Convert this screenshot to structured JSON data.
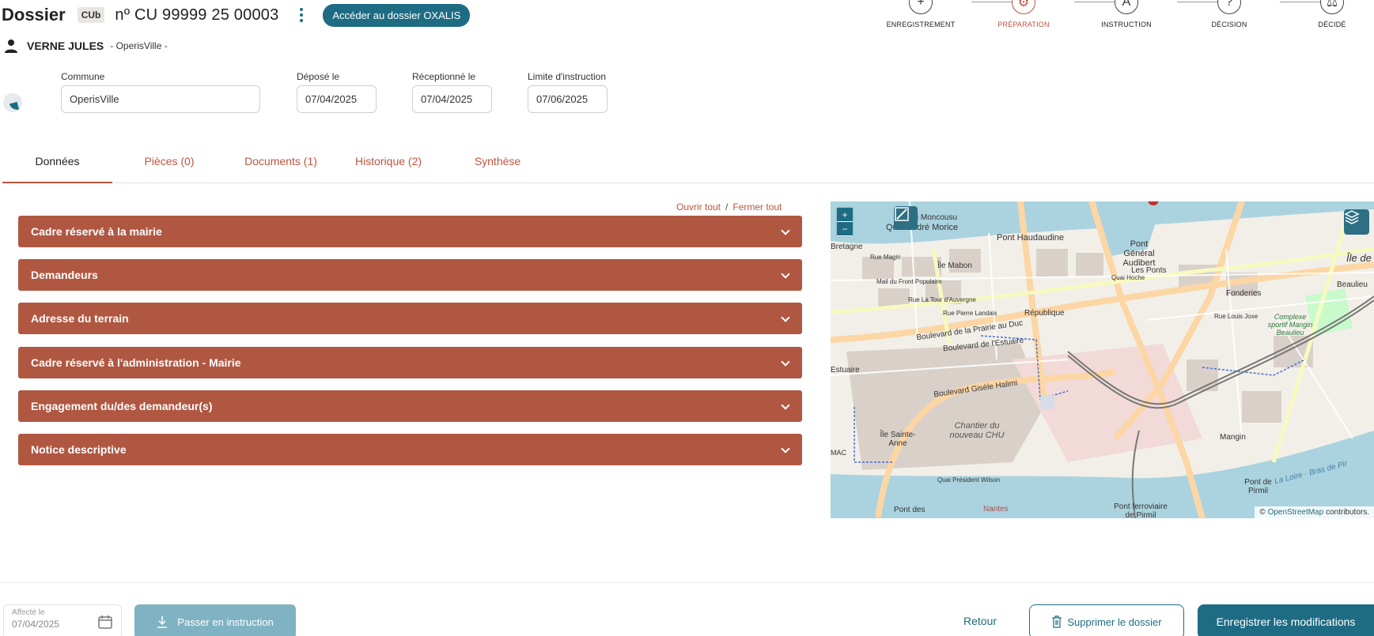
{
  "header": {
    "title": "Dossier",
    "type_badge": "CUb",
    "dossier_number": "nº CU 99999 25 00003",
    "oxalis_button": "Accéder au dossier OXALIS"
  },
  "applicant": {
    "name": "VERNE JULES",
    "city": "- OperisVille -"
  },
  "workflow": {
    "steps": [
      {
        "label": "ENREGISTREMENT",
        "icon": "plus-icon",
        "glyph": "+"
      },
      {
        "label": "PRÉPARATION",
        "icon": "gear-icon",
        "glyph": "⚙"
      },
      {
        "label": "INSTRUCTION",
        "icon": "letter-a-icon",
        "glyph": "A"
      },
      {
        "label": "DÉCISION",
        "icon": "question-icon",
        "glyph": "?"
      },
      {
        "label": "DÉCIDÉ",
        "icon": "gavel-icon",
        "glyph": "⚖"
      }
    ],
    "active_step": "PRÉPARATION"
  },
  "fields": {
    "commune": {
      "label": "Commune",
      "value": "OperisVille"
    },
    "depose": {
      "label": "Déposé le",
      "value": "07/04/2025"
    },
    "receptionne": {
      "label": "Réceptionné le",
      "value": "07/04/2025"
    },
    "limite": {
      "label": "Limite d'instruction",
      "value": "07/06/2025"
    }
  },
  "tabs": [
    {
      "label": "Données"
    },
    {
      "label": "Pièces (0)"
    },
    {
      "label": "Documents (1)"
    },
    {
      "label": "Historique (2)"
    },
    {
      "label": "Synthèse"
    }
  ],
  "open_all": "Ouvrir tout",
  "close_all": "Fermer tout",
  "open_close_separator": "/",
  "sections": [
    {
      "label": "Cadre réservé à la mairie"
    },
    {
      "label": "Demandeurs"
    },
    {
      "label": "Adresse du terrain"
    },
    {
      "label": "Cadre réservé à l'administration - Mairie"
    },
    {
      "label": "Engagement du/des demandeur(s)"
    },
    {
      "label": "Notice descriptive"
    }
  ],
  "map": {
    "zoom_in": "+",
    "zoom_out": "−",
    "attribution_prefix": "©",
    "attribution_link": "OpenStreetMap",
    "attribution_suffix": "contributors.",
    "labels": {
      "quai_moncousu": "Quai Moncousu",
      "quai_andre_morice": "Quai André Morice",
      "pont_haudaudine": "Pont Haudaudine",
      "pont_general_audibert": "Pont Général Audibert",
      "ile_de": "Île de",
      "bretagne": "Bretagne",
      "rue_magin": "Rue Magin",
      "ile_mabon": "Île Mabon",
      "les_ponts": "Les Ponts",
      "quai_hoche": "Quai Hoche",
      "beaulieu": "Beaulieu",
      "mail_front_populaire": "Mail du Front Populaire",
      "fonderies": "Fonderies",
      "rue_tour_auvergne": "Rue La Tour d'Auvergne",
      "rue_pierre_landais": "Rue Pierre Landais",
      "republique": "République",
      "rue_louis_joxe": "Rue Louis Joxe",
      "complexe_sportif": "Complexe sportif Mangin Beaulieu",
      "bd_prairie_duc": "Boulevard de la Prairie au Duc",
      "bd_estuaire": "Boulevard de l'Estuaire",
      "estuaire": "Estuaire",
      "bd_gisele_halimi": "Boulevard Gisèle Halimi",
      "chantier_chu": "Chantier du nouveau CHU",
      "ile_sainte_anne": "Île Sainte-Anne",
      "mangin": "Mangin",
      "quai_president_wilson": "Quai Président Wilson",
      "pont_de_pirmil": "Pont de Pirmil",
      "la_loire": "La Loire · Bras de Pir",
      "pont_des": "Pont des",
      "nantes": "Nantes",
      "pont_ferroviaire": "Pont ferroviaire de Pirmil",
      "mac": "MAC"
    }
  },
  "footer": {
    "affecte_label": "Affecté le",
    "affecte_value": "07/04/2025",
    "passer_button": "Passer en instruction",
    "retour": "Retour",
    "supprimer_button": "Supprimer le dossier",
    "save_button": "Enregistrer les modifications"
  },
  "colors": {
    "primary": "#1e6c83",
    "accent": "#c0543d",
    "section_bg": "#b05742"
  }
}
